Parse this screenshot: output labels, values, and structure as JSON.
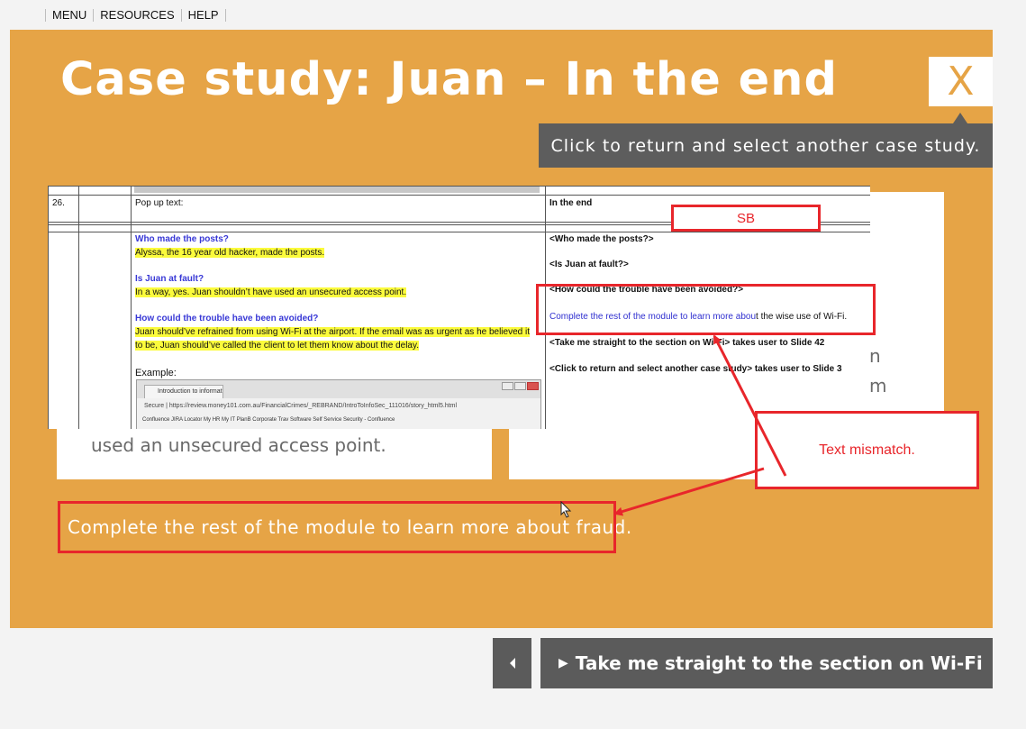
{
  "nav": {
    "items": [
      "MENU",
      "RESOURCES",
      "HELP"
    ]
  },
  "slide": {
    "title": "Case study: Juan – In the end",
    "close_label": "X",
    "tooltip": "Click to return and select another case study.",
    "card_left_text": "used an unsecured access point.",
    "card_right_fragments": [
      "n",
      "m"
    ],
    "body_text": "Complete the rest of the module to learn more about fraud."
  },
  "doc": {
    "row_number": "26.",
    "popup_label": "Pop up text:",
    "right_header": "In the end",
    "q1": "Who made the posts?",
    "a1": "Alyssa, the 16 year old hacker, made the posts.",
    "q2": "Is Juan at fault?",
    "a2": "In a way, yes. Juan shouldn’t have used an unsecured access point.",
    "q3": "How could the trouble have been avoided?",
    "a3_line1": "Juan should’ve refrained from using Wi-Fi at the airport. If the email was as urgent as he believed it",
    "a3_line2": "to be, Juan should’ve called the client to let them know about the delay.",
    "example_label": "Example:",
    "r1": "<Who made the posts?>",
    "r2": "<Is Juan at fault?>",
    "r3": "<How could the trouble have been avoided?>",
    "r4_link": "Complete the rest of the module to learn more abou",
    "r4_rest": "t the wise use of Wi-Fi.",
    "r5": "<Take me straight to the section on Wi-Fi> takes user to Slide 42",
    "r6": "<Click to return and select another case study> takes user to Slide 3",
    "browser": {
      "tab_title": "Introduction to informat",
      "url": "Secure  |  https://review.money101.com.au/FinancialCrimes/_REBRAND/IntroToInfoSec_111016/story_html5.html",
      "bookmarks": "Confluence    JIRA    Locator    My HR    My IT    PlanB Corporate Trav    Software Self Service    Security - Confluence"
    }
  },
  "annotations": {
    "sb": "SB",
    "mismatch": "Text mismatch.",
    "color": "#e8262b"
  },
  "footer": {
    "back_icon": "left-triangle-icon",
    "wifi_label": "Take me straight to the section on Wi-Fi"
  },
  "colors": {
    "stage": "#e6a446",
    "dark_button": "#5b5b5b",
    "tooltip_bg": "#5d5d5d"
  }
}
